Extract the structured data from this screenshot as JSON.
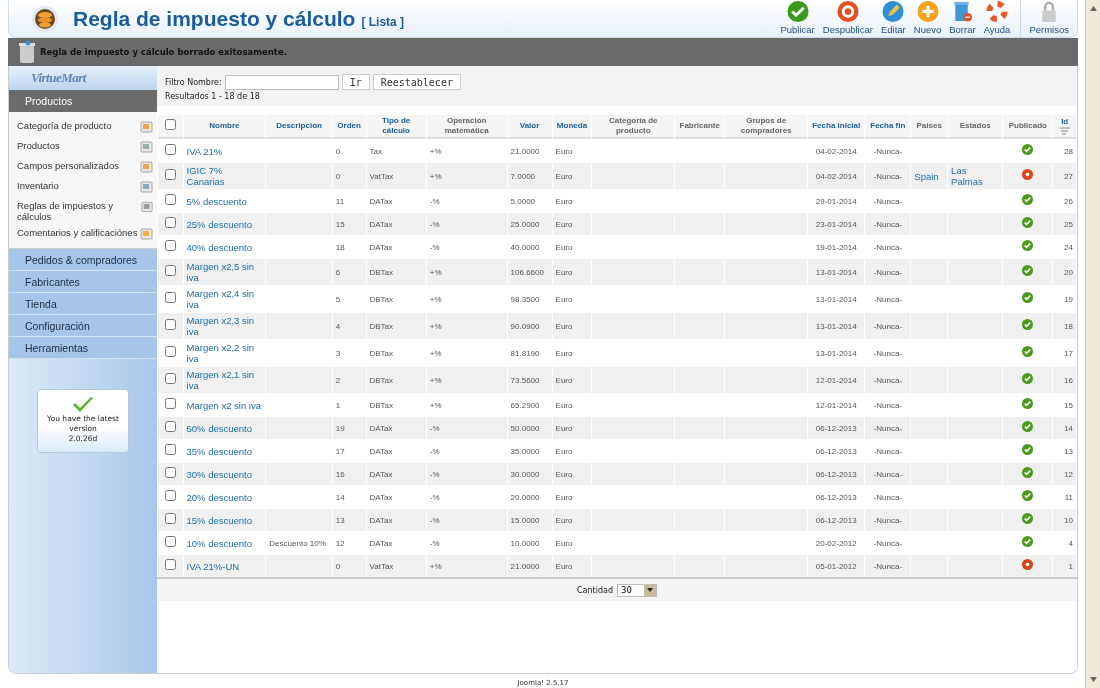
{
  "header": {
    "title": "Regla de impuesto y cálculo",
    "subtitle": "[ Lista ]"
  },
  "toolbar": [
    {
      "kind": "publish",
      "label": "Publicar"
    },
    {
      "kind": "unpublish",
      "label": "Despublicar"
    },
    {
      "kind": "edit",
      "label": "Editar"
    },
    {
      "kind": "new",
      "label": "Nuevo"
    },
    {
      "kind": "delete",
      "label": "Borrar"
    },
    {
      "kind": "help",
      "label": "Ayuda"
    },
    {
      "kind": "permissions",
      "label": "Permisos"
    }
  ],
  "message": "Regla de impuesto y cálculo borrado exitosamente.",
  "sidebar": {
    "logo": "VirtueMart",
    "sections": [
      {
        "label": "Productos",
        "expanded": true,
        "items": [
          {
            "label": "Categoría de producto"
          },
          {
            "label": "Productos"
          },
          {
            "label": "Campos personalizados"
          },
          {
            "label": "Inventario"
          },
          {
            "label": "Reglas de impuestos y cálculos"
          },
          {
            "label": "Comentarios y calificaciónes"
          }
        ]
      },
      {
        "label": "Pedidos & compradores",
        "expanded": false
      },
      {
        "label": "Fabricantes",
        "expanded": false
      },
      {
        "label": "Tienda",
        "expanded": false
      },
      {
        "label": "Configuración",
        "expanded": false
      },
      {
        "label": "Herramientas",
        "expanded": false
      }
    ],
    "version_box": {
      "message": "You have the latest version",
      "version": "2.0.26d"
    }
  },
  "filter": {
    "label": "Filtro Nombre:",
    "go": "Ir",
    "reset": "Reestablecer",
    "results": "Resultados 1 - 18 de 18"
  },
  "table": {
    "select_all_checked": false,
    "columns": [
      {
        "label": "Nombre",
        "sortable": true
      },
      {
        "label": "Descripción",
        "sortable": true
      },
      {
        "label": "Orden",
        "sortable": true
      },
      {
        "label": "Tipo de cálculo",
        "sortable": true
      },
      {
        "label": "Operación matemática",
        "sortable": false
      },
      {
        "label": "Valor",
        "sortable": true
      },
      {
        "label": "Moneda",
        "sortable": true
      },
      {
        "label": "Categoría de producto",
        "sortable": false
      },
      {
        "label": "Fabricante",
        "sortable": false
      },
      {
        "label": "Grupos de compradores",
        "sortable": false
      },
      {
        "label": "Fecha inicial",
        "sortable": true
      },
      {
        "label": "Fecha fin",
        "sortable": true
      },
      {
        "label": "Paises",
        "sortable": false
      },
      {
        "label": "Estados",
        "sortable": false
      },
      {
        "label": "Publicado",
        "sortable": false
      },
      {
        "label": "Id",
        "sortable": true,
        "sorted": true
      }
    ],
    "rows": [
      {
        "checked": false,
        "name": "IVA 21%",
        "order": "0",
        "calc_type": "Tax",
        "operation": "+%",
        "value": "21.0000",
        "currency": "Euro",
        "start": "04-02-2014",
        "end": "-Nunca-",
        "published": true,
        "id": "28"
      },
      {
        "checked": false,
        "name": "IGIC 7% Canarias",
        "order": "0",
        "calc_type": "VatTax",
        "operation": "+%",
        "value": "7.0000",
        "currency": "Euro",
        "start": "04-02-2014",
        "end": "-Nunca-",
        "countries": "Spain",
        "states": "Las Palmas",
        "published": false,
        "id": "27"
      },
      {
        "checked": false,
        "name": "5% descuento",
        "order": "11",
        "calc_type": "DATax",
        "operation": "-%",
        "value": "5.0000",
        "currency": "Euro",
        "start": "29-01-2014",
        "end": "-Nunca-",
        "published": true,
        "id": "26"
      },
      {
        "checked": false,
        "name": "25% descuento",
        "order": "15",
        "calc_type": "DATax",
        "operation": "-%",
        "value": "25.0000",
        "currency": "Euro",
        "start": "23-01-2014",
        "end": "-Nunca-",
        "published": true,
        "id": "25"
      },
      {
        "checked": false,
        "name": "40% descuento",
        "order": "18",
        "calc_type": "DATax",
        "operation": "-%",
        "value": "40.0000",
        "currency": "Euro",
        "start": "19-01-2014",
        "end": "-Nunca-",
        "published": true,
        "id": "24"
      },
      {
        "checked": false,
        "name": "Margen x2,5 sin iva",
        "order": "6",
        "calc_type": "DBTax",
        "operation": "+%",
        "value": "106.6600",
        "currency": "Euro",
        "start": "13-01-2014",
        "end": "-Nunca-",
        "published": true,
        "id": "20"
      },
      {
        "checked": false,
        "name": "Margen x2,4 sin iva",
        "order": "5",
        "calc_type": "DBTax",
        "operation": "+%",
        "value": "98.3500",
        "currency": "Euro",
        "start": "13-01-2014",
        "end": "-Nunca-",
        "published": true,
        "id": "19"
      },
      {
        "checked": false,
        "name": "Margen x2,3 sin iva",
        "order": "4",
        "calc_type": "DBTax",
        "operation": "+%",
        "value": "90.0900",
        "currency": "Euro",
        "start": "13-01-2014",
        "end": "-Nunca-",
        "published": true,
        "id": "18"
      },
      {
        "checked": false,
        "name": "Margen x2,2 sin iva",
        "order": "3",
        "calc_type": "DBTax",
        "operation": "+%",
        "value": "81.8190",
        "currency": "Euro",
        "start": "13-01-2014",
        "end": "-Nunca-",
        "published": true,
        "id": "17"
      },
      {
        "checked": false,
        "name": "Margen x2,1 sin iva",
        "order": "2",
        "calc_type": "DBTax",
        "operation": "+%",
        "value": "73.5600",
        "currency": "Euro",
        "start": "12-01-2014",
        "end": "-Nunca-",
        "published": true,
        "id": "16"
      },
      {
        "checked": false,
        "name": "Margen x2 sin iva",
        "order": "1",
        "calc_type": "DBTax",
        "operation": "+%",
        "value": "65.2900",
        "currency": "Euro",
        "start": "12-01-2014",
        "end": "-Nunca-",
        "published": true,
        "id": "15"
      },
      {
        "checked": false,
        "name": "50% descuento",
        "order": "19",
        "calc_type": "DATax",
        "operation": "-%",
        "value": "50.0000",
        "currency": "Euro",
        "start": "06-12-2013",
        "end": "-Nunca-",
        "published": true,
        "id": "14"
      },
      {
        "checked": false,
        "name": "35% descuento",
        "order": "17",
        "calc_type": "DATax",
        "operation": "-%",
        "value": "35.0000",
        "currency": "Euro",
        "start": "06-12-2013",
        "end": "-Nunca-",
        "published": true,
        "id": "13"
      },
      {
        "checked": false,
        "name": "30% descuento",
        "order": "16",
        "calc_type": "DATax",
        "operation": "-%",
        "value": "30.0000",
        "currency": "Euro",
        "start": "06-12-2013",
        "end": "-Nunca-",
        "published": true,
        "id": "12"
      },
      {
        "checked": false,
        "name": "20% descuento",
        "order": "14",
        "calc_type": "DATax",
        "operation": "-%",
        "value": "20.0000",
        "currency": "Euro",
        "start": "06-12-2013",
        "end": "-Nunca-",
        "published": true,
        "id": "11"
      },
      {
        "checked": false,
        "name": "15% descuento",
        "order": "13",
        "calc_type": "DATax",
        "operation": "-%",
        "value": "15.0000",
        "currency": "Euro",
        "start": "06-12-2013",
        "end": "-Nunca-",
        "published": true,
        "id": "10"
      },
      {
        "checked": false,
        "name": "10% descuento",
        "description": "Descuento 10%",
        "order": "12",
        "calc_type": "DATax",
        "operation": "-%",
        "value": "10.0000",
        "currency": "Euro",
        "start": "20-02-2012",
        "end": "-Nunca-",
        "published": true,
        "id": "4"
      },
      {
        "checked": false,
        "name": "IVA 21%-UN",
        "order": "0",
        "calc_type": "VatTax",
        "operation": "+%",
        "value": "21.0000",
        "currency": "Euro",
        "start": "05-01-2012",
        "end": "-Nunca-",
        "published": false,
        "id": "1"
      }
    ]
  },
  "pagination": {
    "label": "Cantidad",
    "value": "30"
  },
  "footer": "Joomla! 2.5.17"
}
